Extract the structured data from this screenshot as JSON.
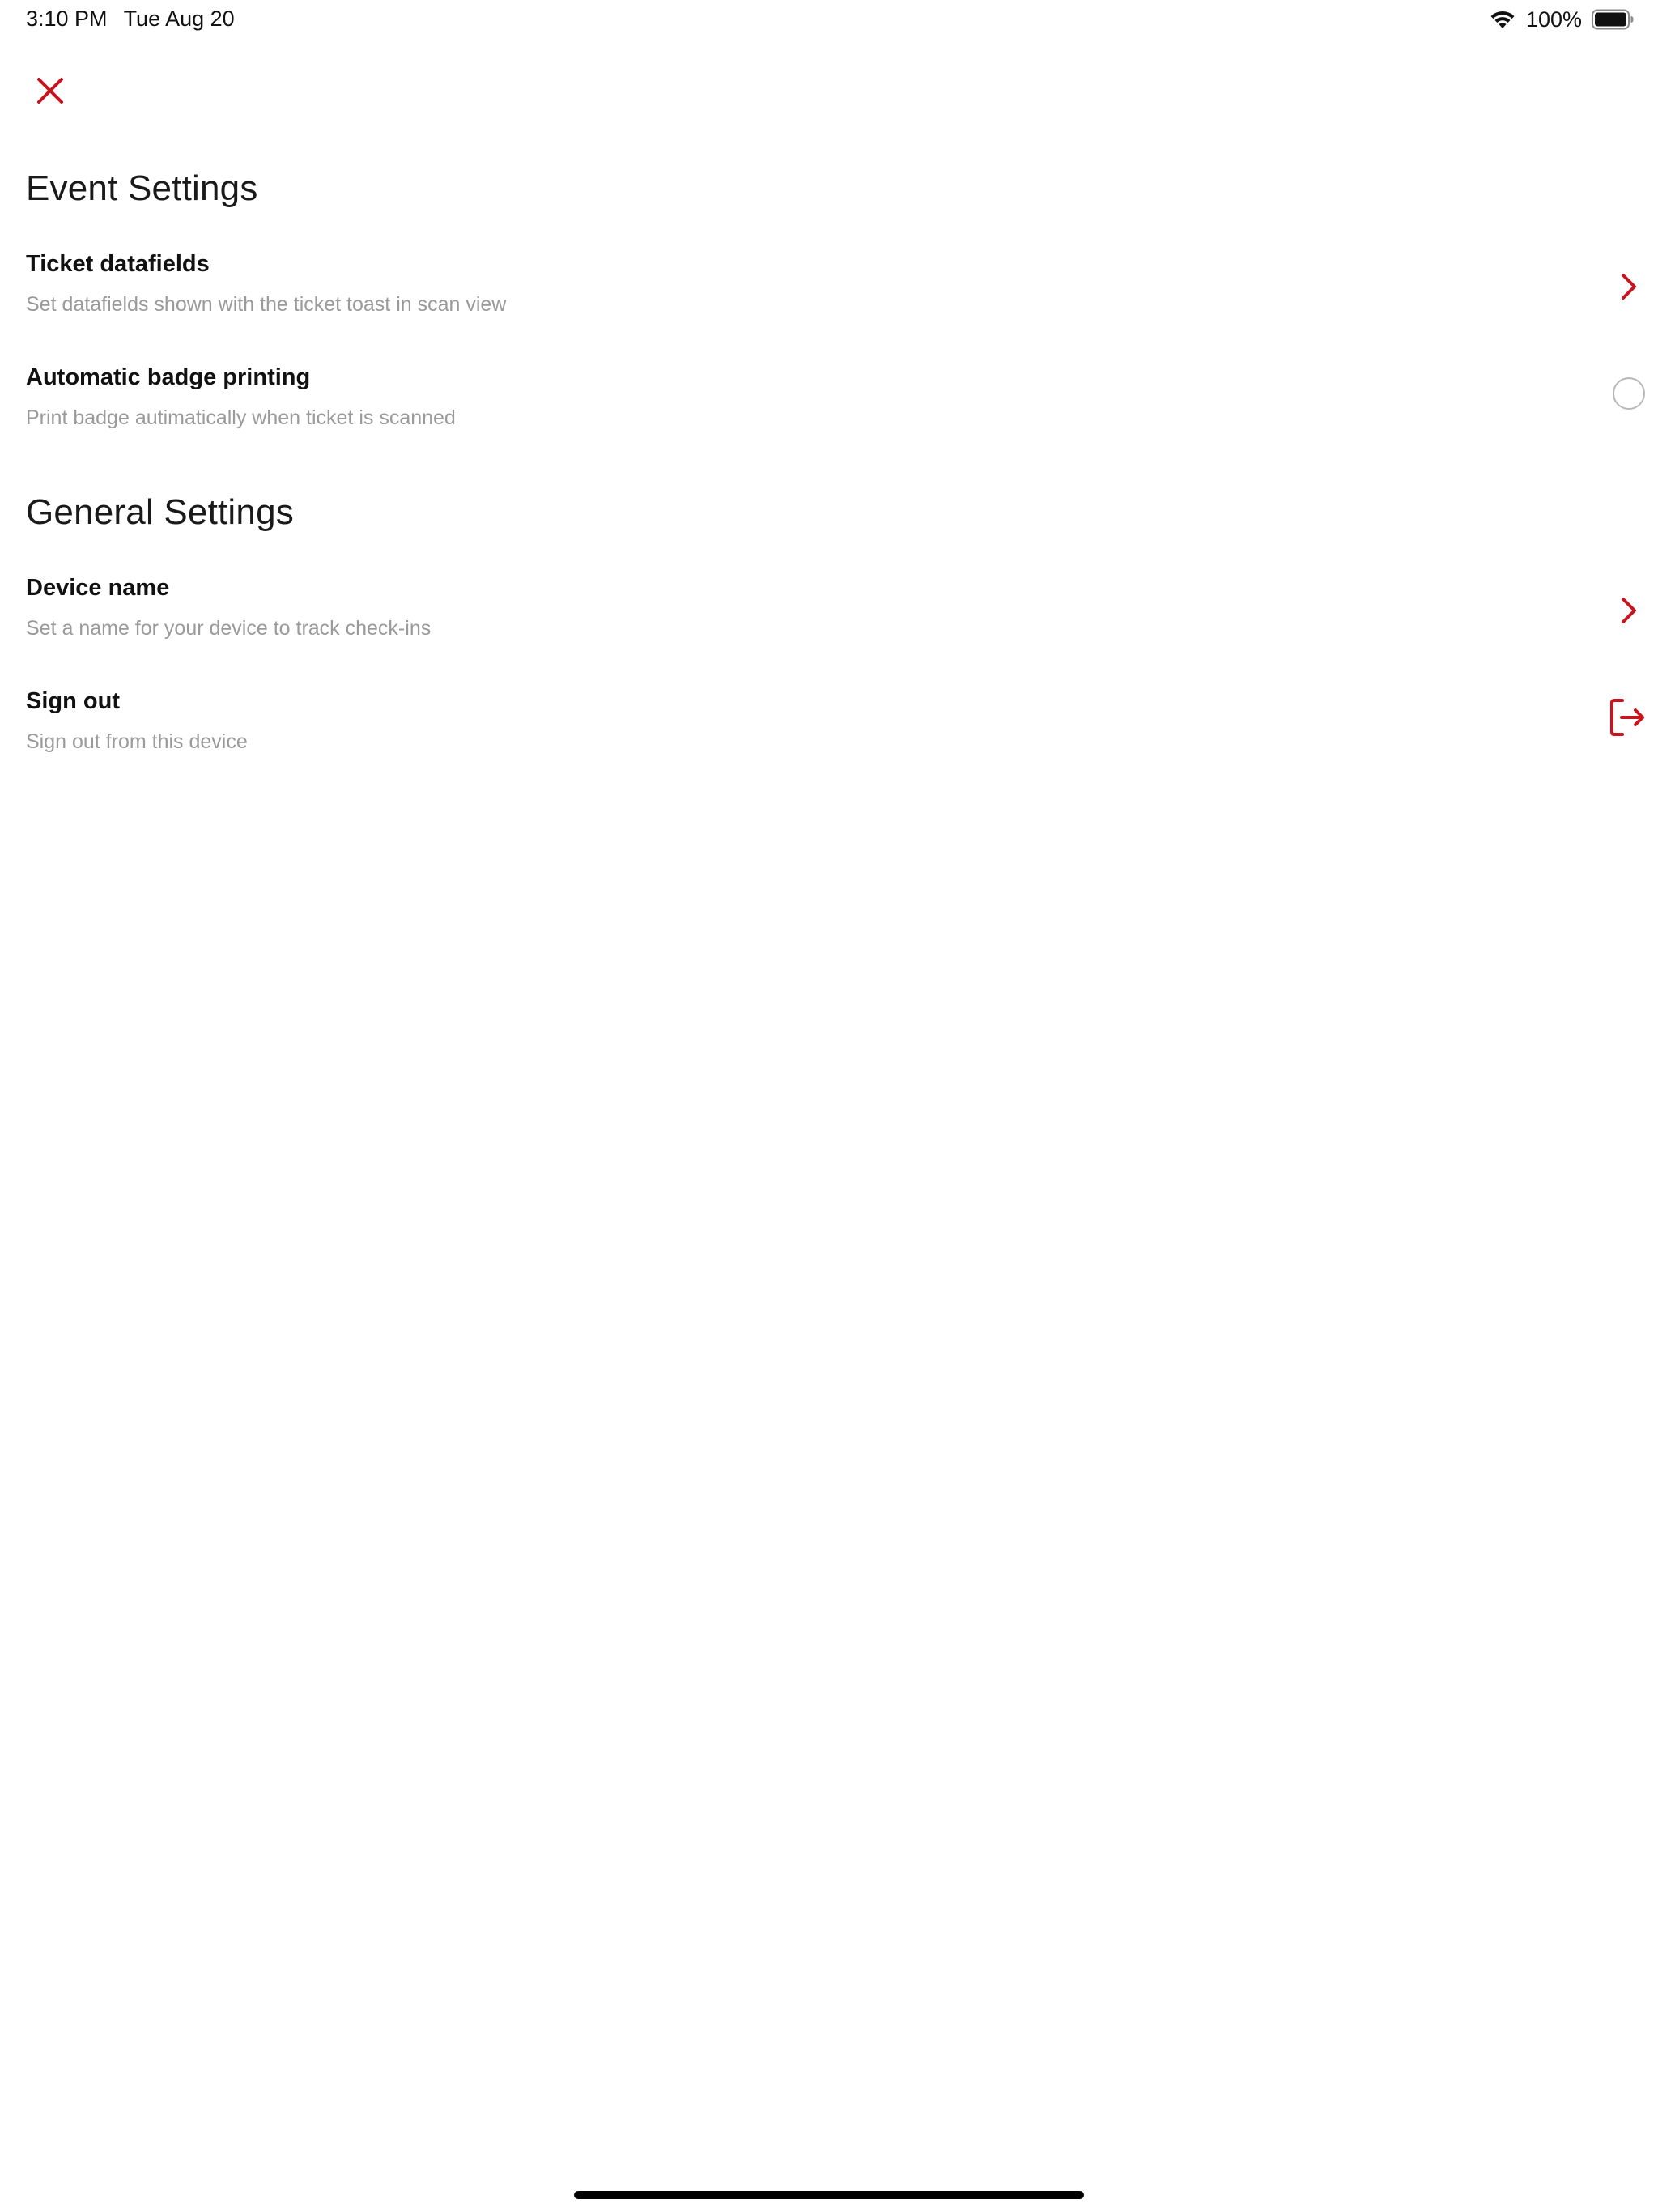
{
  "status_bar": {
    "time": "3:10 PM",
    "date": "Tue Aug 20",
    "battery_percent": "100%",
    "battery_level": 1.0,
    "icons": [
      "wifi-icon",
      "battery-icon"
    ]
  },
  "header": {
    "close_icon": "close-icon"
  },
  "colors": {
    "accent": "#c8141e",
    "title": "#111111",
    "subtitle": "#9a9a9a"
  },
  "event_settings": {
    "title": "Event Settings",
    "items": [
      {
        "title": "Ticket datafields",
        "subtitle": "Set datafields shown with the ticket toast in scan view",
        "accessory": "chevron-right-icon"
      },
      {
        "title": "Automatic badge printing",
        "subtitle": "Print badge autimatically when ticket is scanned",
        "accessory": "radio-toggle",
        "checked": false
      }
    ]
  },
  "general_settings": {
    "title": "General Settings",
    "items": [
      {
        "title": "Device name",
        "subtitle": "Set a name for your device to track check-ins",
        "accessory": "chevron-right-icon"
      },
      {
        "title": "Sign out",
        "subtitle": "Sign out from this device",
        "accessory": "sign-out-icon"
      }
    ]
  }
}
